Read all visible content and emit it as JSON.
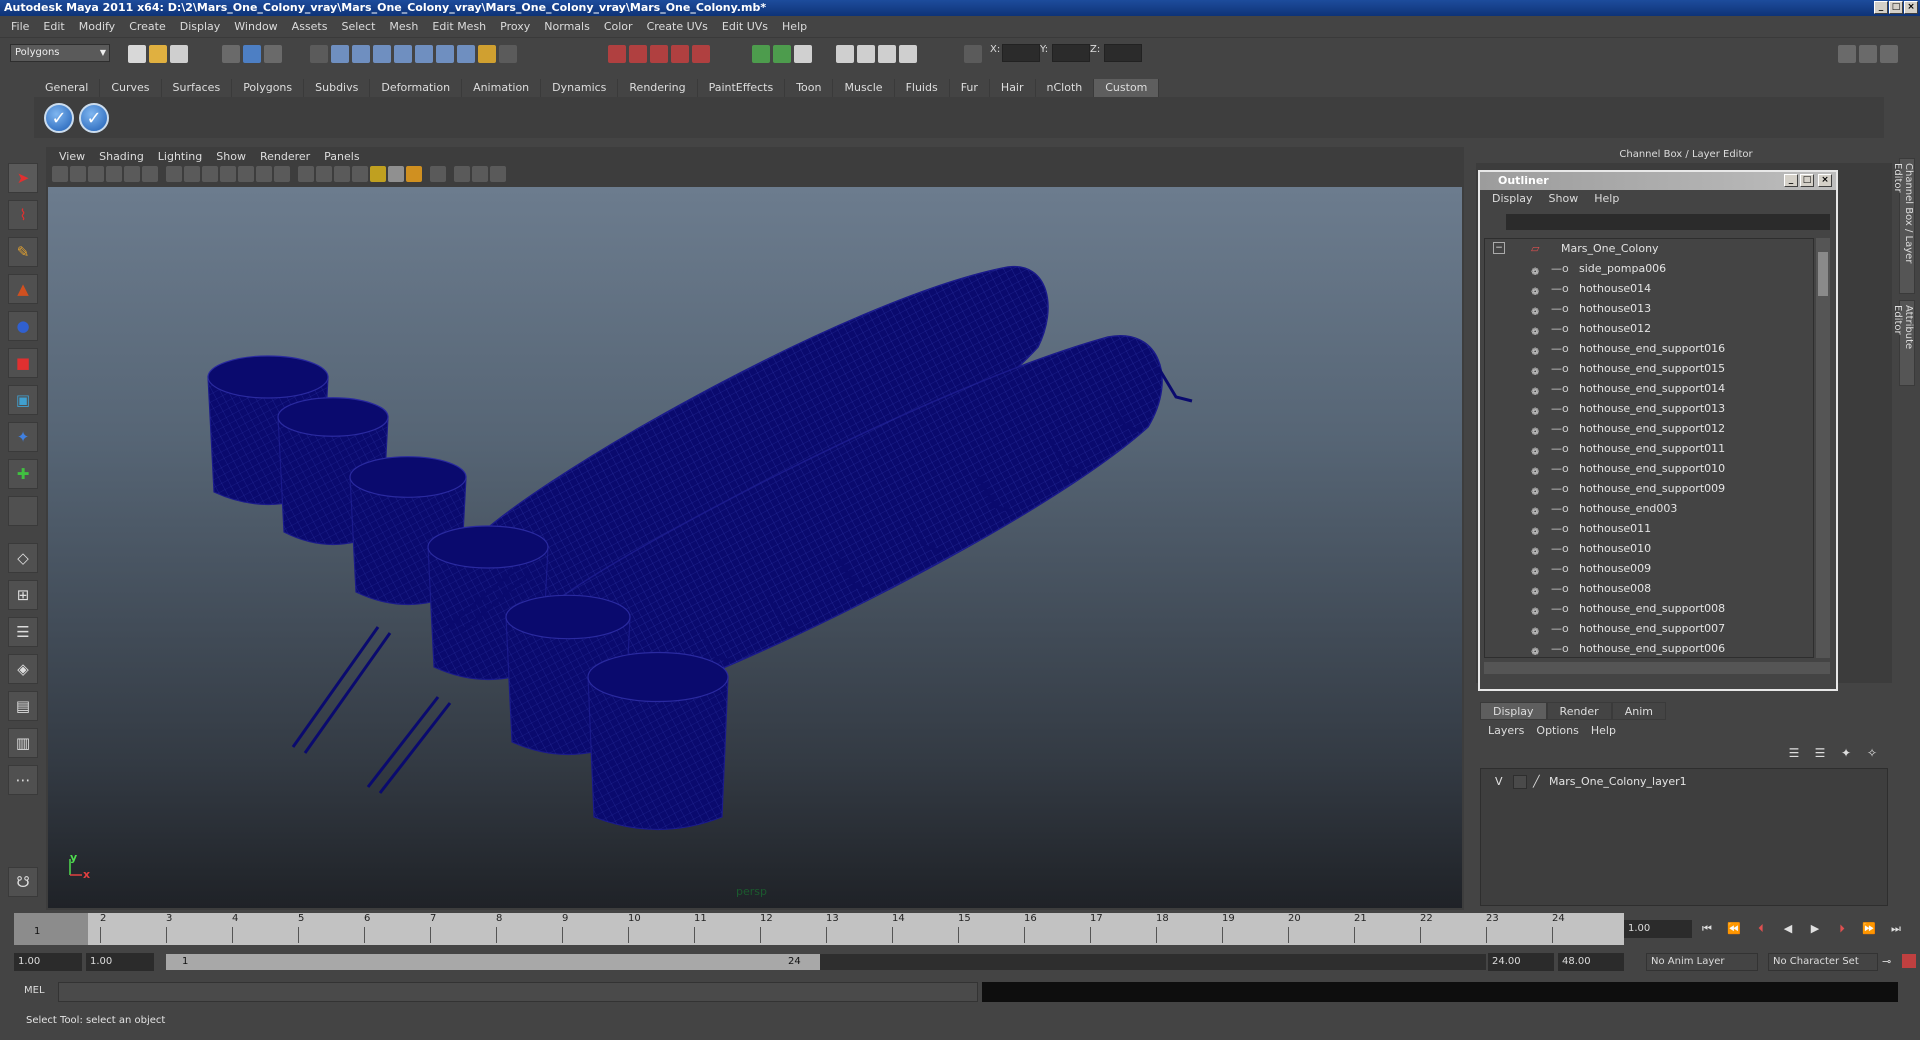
{
  "window": {
    "title": "Autodesk Maya 2011 x64: D:\\2\\Mars_One_Colony_vray\\Mars_One_Colony_vray\\Mars_One_Colony_vray\\Mars_One_Colony.mb*"
  },
  "menubar": [
    "File",
    "Edit",
    "Modify",
    "Create",
    "Display",
    "Window",
    "Assets",
    "Select",
    "Mesh",
    "Edit Mesh",
    "Proxy",
    "Normals",
    "Color",
    "Create UVs",
    "Edit UVs",
    "Help"
  ],
  "statusline": {
    "mode": "Polygons",
    "x_label": "X:",
    "y_label": "Y:",
    "z_label": "Z:"
  },
  "shelf": {
    "tabs": [
      "General",
      "Curves",
      "Surfaces",
      "Polygons",
      "Subdivs",
      "Deformation",
      "Animation",
      "Dynamics",
      "Rendering",
      "PaintEffects",
      "Toon",
      "Muscle",
      "Fluids",
      "Fur",
      "Hair",
      "nCloth",
      "Custom"
    ],
    "active_tab": "Custom"
  },
  "viewport": {
    "menu": [
      "View",
      "Shading",
      "Lighting",
      "Show",
      "Renderer",
      "Panels"
    ],
    "camera_label": "persp",
    "axis_y": "y",
    "axis_x": "x",
    "wire_color": "#0a0a6e"
  },
  "channel_box": {
    "title": "Channel Box / Layer Editor"
  },
  "side_tabs": [
    "Channel Box / Layer Editor",
    "Attribute Editor"
  ],
  "outliner": {
    "title": "Outliner",
    "menu": [
      "Display",
      "Show",
      "Help"
    ],
    "root": "Mars_One_Colony",
    "items": [
      "side_pompa006",
      "hothouse014",
      "hothouse013",
      "hothouse012",
      "hothouse_end_support016",
      "hothouse_end_support015",
      "hothouse_end_support014",
      "hothouse_end_support013",
      "hothouse_end_support012",
      "hothouse_end_support011",
      "hothouse_end_support010",
      "hothouse_end_support009",
      "hothouse_end003",
      "hothouse011",
      "hothouse010",
      "hothouse009",
      "hothouse008",
      "hothouse_end_support008",
      "hothouse_end_support007",
      "hothouse_end_support006"
    ]
  },
  "layer_editor": {
    "tabs": [
      "Display",
      "Render",
      "Anim"
    ],
    "active_tab": "Display",
    "menu": [
      "Layers",
      "Options",
      "Help"
    ],
    "layer_visible": "V",
    "layer_name": "Mars_One_Colony_layer1"
  },
  "timeline": {
    "ticks": [
      "1",
      "2",
      "3",
      "4",
      "5",
      "6",
      "7",
      "8",
      "9",
      "10",
      "11",
      "12",
      "13",
      "14",
      "15",
      "16",
      "17",
      "18",
      "19",
      "20",
      "21",
      "22",
      "23",
      "24"
    ],
    "current_frame": "1",
    "current_frame_field": "1.00"
  },
  "range": {
    "start_time": "1.00",
    "playback_start": "1.00",
    "range_start": "1",
    "range_end": "24",
    "playback_end": "24.00",
    "end_time": "48.00",
    "anim_layer": "No Anim Layer",
    "character_set": "No Character Set"
  },
  "commandline": {
    "label": "MEL"
  },
  "helpline": {
    "text": "Select Tool: select an object"
  }
}
